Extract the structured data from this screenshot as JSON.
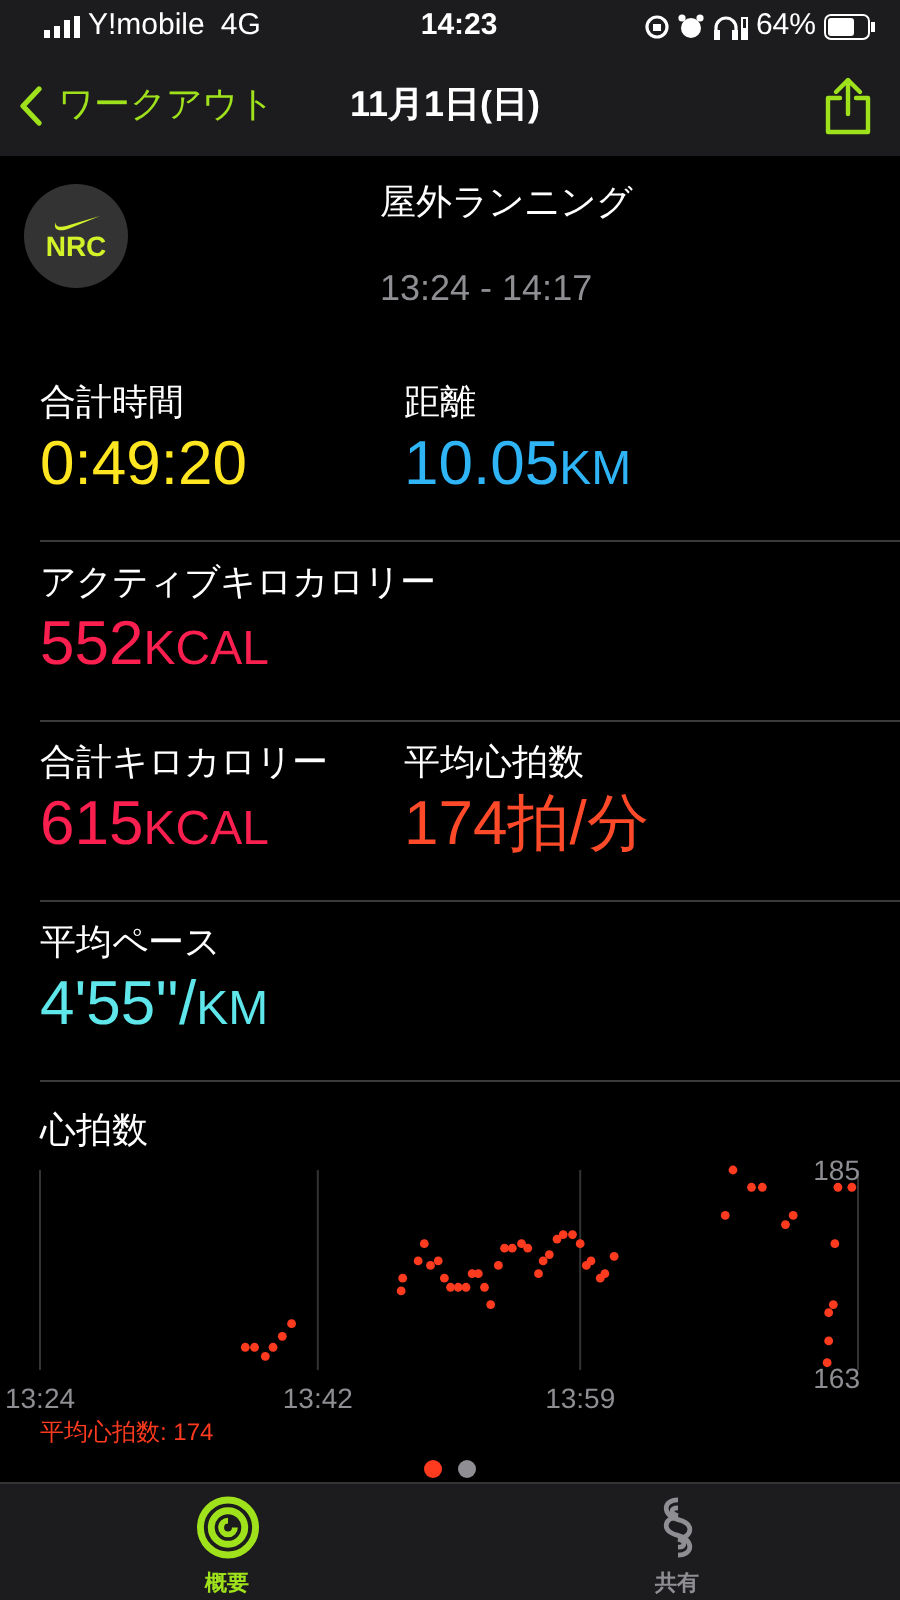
{
  "status_bar": {
    "carrier": "Y!mobile",
    "network": "4G",
    "time": "14:23",
    "battery": "64%"
  },
  "nav": {
    "back": "ワークアウト",
    "title": "11月1日(日)"
  },
  "workout": {
    "app": "NRC",
    "type": "屋外ランニング",
    "time_range": "13:24 - 14:17"
  },
  "metric_rows": [
    [
      {
        "label": "合計時間",
        "value": "0:49:20",
        "color": "#ffe620"
      },
      {
        "label": "距離",
        "value": "10.05",
        "unit": "KM",
        "color": "#2fb4f6"
      }
    ],
    [
      {
        "label": "アクティブキロカロリー",
        "value": "552",
        "unit": "KCAL",
        "color": "#fa1f4e"
      }
    ],
    [
      {
        "label": "合計キロカロリー",
        "value": "615",
        "unit": "KCAL",
        "color": "#fa1f4e"
      },
      {
        "label": "平均心拍数",
        "value": "174拍/分",
        "color": "#ff4a2a"
      }
    ],
    [
      {
        "label": "平均ペース",
        "value": "4'55''/",
        "unit": "KM",
        "color": "#5ee6ea"
      }
    ]
  ],
  "heart_rate": {
    "average": "平均心拍数: 174",
    "chart_data": {
      "type": "scatter",
      "title": "心拍数",
      "xlim": [
        804,
        857
      ],
      "ylim": [
        163,
        185
      ],
      "xticks": [
        {
          "value": 804,
          "label": "13:24"
        },
        {
          "value": 822,
          "label": "13:42"
        },
        {
          "value": 839,
          "label": "13:59"
        }
      ],
      "yticks": [
        {
          "value": 163,
          "label": "163"
        },
        {
          "value": 185,
          "label": "185"
        }
      ],
      "series": [
        {
          "color": "#ff3b1f",
          "x": [
            817.3,
            817.9,
            818.6,
            819.1,
            819.7,
            820.3,
            827.4,
            827.5,
            828.5,
            828.9,
            829.3,
            829.8,
            830.2,
            830.6,
            831.1,
            831.6,
            832.0,
            832.4,
            832.8,
            833.2,
            833.7,
            834.1,
            834.6,
            835.2,
            835.6,
            836.3,
            836.6,
            837.0,
            837.5,
            837.9,
            838.5,
            839.0,
            839.4,
            839.7,
            840.3,
            840.6,
            841.2,
            848.4,
            848.9,
            850.1,
            850.8,
            852.3,
            852.8,
            855.1,
            855.4,
            855.1,
            855.0,
            855.5,
            855.7,
            856.6
          ],
          "values": [
            165.5,
            165.5,
            164.5,
            165.5,
            166.7,
            168.1,
            171.7,
            173.1,
            175.0,
            176.9,
            174.5,
            175.0,
            173.1,
            172.1,
            172.1,
            172.1,
            173.6,
            173.6,
            172.1,
            170.2,
            174.5,
            176.4,
            176.4,
            176.9,
            176.4,
            173.6,
            175.0,
            175.7,
            177.4,
            177.9,
            177.9,
            176.9,
            174.5,
            175.0,
            173.1,
            173.6,
            175.5,
            180.0,
            185.0,
            183.1,
            183.1,
            179.0,
            180.0,
            169.3,
            170.2,
            166.2,
            163.8,
            176.9,
            183.1,
            183.1
          ]
        }
      ]
    }
  },
  "page_dots": [
    {
      "selected": true
    },
    {
      "selected": false
    }
  ],
  "tabs": [
    {
      "label": "概要",
      "selected": true
    },
    {
      "label": "共有",
      "selected": false
    }
  ]
}
